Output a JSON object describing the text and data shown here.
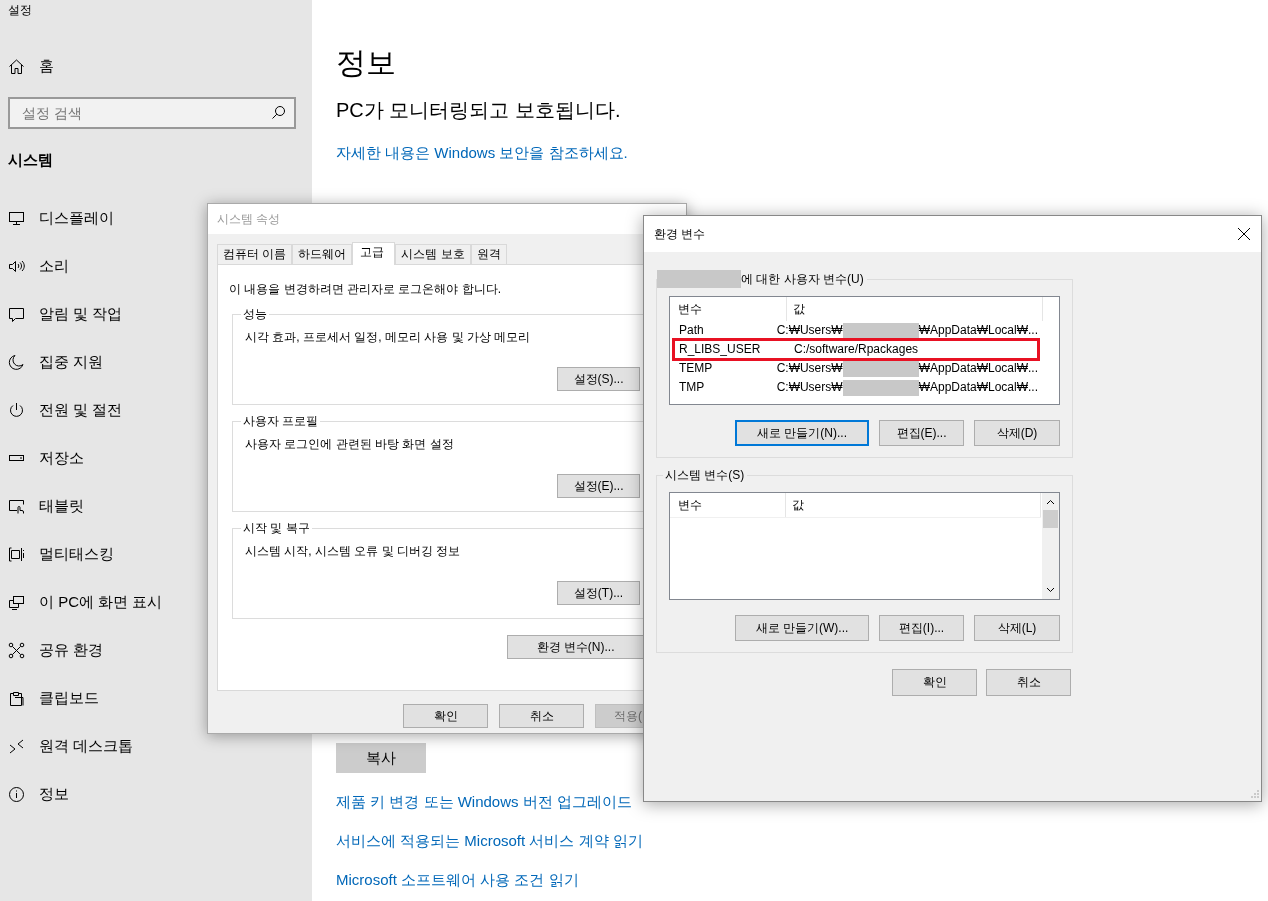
{
  "settings": {
    "app_title": "설정",
    "home": "홈",
    "search": {
      "placeholder": "설정 검색"
    },
    "section": "시스템",
    "nav_items": [
      {
        "label": "디스플레이"
      },
      {
        "label": "소리"
      },
      {
        "label": "알림 및 작업"
      },
      {
        "label": "집중 지원"
      },
      {
        "label": "전원 및 절전"
      },
      {
        "label": "저장소"
      },
      {
        "label": "태블릿"
      },
      {
        "label": "멀티태스킹"
      },
      {
        "label": "이 PC에 화면 표시"
      },
      {
        "label": "공유 환경"
      },
      {
        "label": "클립보드"
      },
      {
        "label": "원격 데스크톱"
      },
      {
        "label": "정보"
      }
    ]
  },
  "main": {
    "title": "정보",
    "status": "PC가 모니터링되고 보호됩니다.",
    "security_link": "자세한 내용은 Windows 보안을 참조하세요.",
    "copy_button": "복사",
    "links": [
      "제품 키 변경 또는 Windows 버전 업그레이드",
      "서비스에 적용되는 Microsoft 서비스 계약 읽기",
      "Microsoft 소프트웨어 사용 조건 읽기"
    ]
  },
  "system_properties": {
    "title": "시스템 속성",
    "active": false,
    "tabs": [
      {
        "label": "컴퓨터 이름",
        "selected": false
      },
      {
        "label": "하드웨어",
        "selected": false
      },
      {
        "label": "고급",
        "selected": true
      },
      {
        "label": "시스템 보호",
        "selected": false
      },
      {
        "label": "원격",
        "selected": false
      }
    ],
    "notice": "이 내용을 변경하려면 관리자로 로그온해야 합니다.",
    "groups": [
      {
        "title": "성능",
        "description": "시각 효과, 프로세서 일정, 메모리 사용 및 가상 메모리",
        "button": "설정(S)..."
      },
      {
        "title": "사용자 프로필",
        "description": "사용자 로그인에 관련된 바탕 화면 설정",
        "button": "설정(E)..."
      },
      {
        "title": "시작 및 복구",
        "description": "시스템 시작, 시스템 오류 및 디버깅 정보",
        "button": "설정(T)..."
      }
    ],
    "env_button": "환경 변수(N)...",
    "buttons": [
      {
        "label": "확인",
        "disabled": false
      },
      {
        "label": "취소",
        "disabled": false
      },
      {
        "label": "적용(",
        "disabled": true
      }
    ]
  },
  "environment_variables": {
    "title": "환경 변수",
    "active": true,
    "user_group": {
      "redacted_prefix": true,
      "label": "에 대한 사용자 변수(U)",
      "columns": [
        "변수",
        "값"
      ],
      "rows": [
        {
          "name": "Path",
          "value": [
            "C:₩Users₩",
            "₩AppData₩Local₩..."
          ],
          "marked": false
        },
        {
          "name": "R_LIBS_USER",
          "value": [
            "C:/software/Rpackages"
          ],
          "marked": true
        },
        {
          "name": "TEMP",
          "value": [
            "C:₩Users₩",
            "₩AppData₩Local₩..."
          ],
          "marked": false
        },
        {
          "name": "TMP",
          "value": [
            "C:₩Users₩",
            "₩AppData₩Local₩..."
          ],
          "marked": false
        }
      ],
      "buttons": [
        {
          "label": "새로 만들기(N)...",
          "focused": true
        },
        {
          "label": "편집(E)...",
          "focused": false
        },
        {
          "label": "삭제(D)",
          "focused": false
        }
      ]
    },
    "system_group": {
      "label": "시스템 변수(S)",
      "columns": [
        "변수",
        "값"
      ],
      "buttons": [
        {
          "label": "새로 만들기(W)...",
          "focused": false
        },
        {
          "label": "편집(I)...",
          "focused": false
        },
        {
          "label": "삭제(L)",
          "focused": false
        }
      ]
    },
    "buttons": [
      "확인",
      "취소"
    ]
  }
}
